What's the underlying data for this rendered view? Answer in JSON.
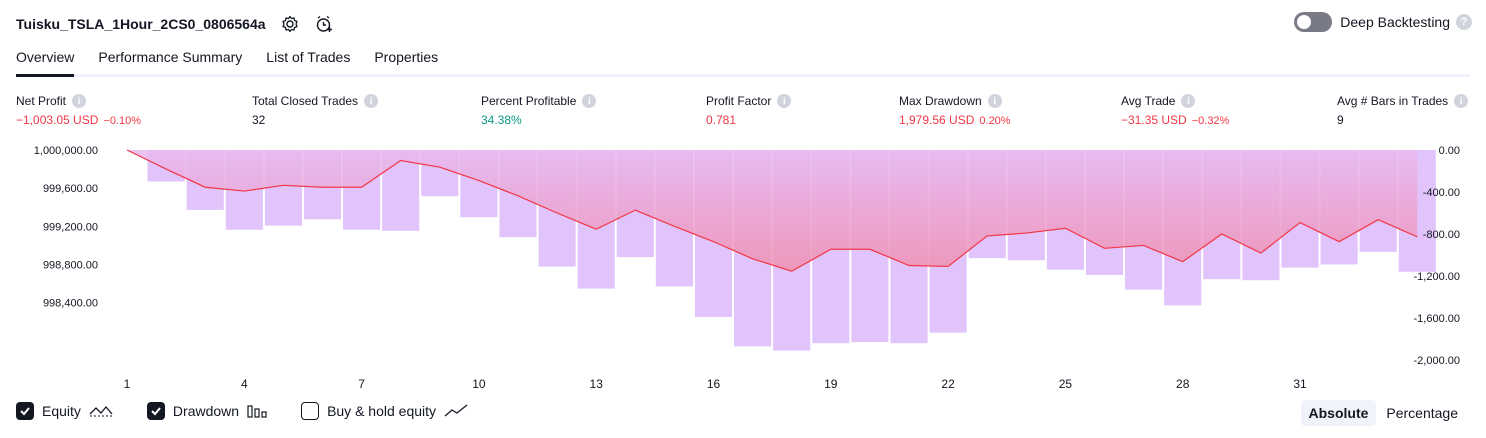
{
  "header": {
    "title": "Tuisku_TSLA_1Hour_2CS0_0806564a",
    "settings_icon": "gear-icon",
    "alert_icon": "add-alert-icon"
  },
  "deep_backtesting": {
    "label": "Deep Backtesting",
    "enabled": false,
    "help": "?"
  },
  "tabs": [
    {
      "label": "Overview",
      "active": true
    },
    {
      "label": "Performance Summary",
      "active": false
    },
    {
      "label": "List of Trades",
      "active": false
    },
    {
      "label": "Properties",
      "active": false
    }
  ],
  "metrics": [
    {
      "label": "Net Profit",
      "value": "−1,003.05 USD",
      "sub": "−0.10%",
      "tone": "neg"
    },
    {
      "label": "Total Closed Trades",
      "value": "32",
      "sub": "",
      "tone": "neu"
    },
    {
      "label": "Percent Profitable",
      "value": "34.38%",
      "sub": "",
      "tone": "pos"
    },
    {
      "label": "Profit Factor",
      "value": "0.781",
      "sub": "",
      "tone": "neg"
    },
    {
      "label": "Max Drawdown",
      "value": "1,979.56 USD",
      "sub": "0.20%",
      "tone": "neg"
    },
    {
      "label": "Avg Trade",
      "value": "−31.35 USD",
      "sub": "−0.32%",
      "tone": "neg"
    },
    {
      "label": "Avg # Bars in Trades",
      "value": "9",
      "sub": "",
      "tone": "neu"
    }
  ],
  "colors": {
    "equity_line": "#f23645",
    "drawdown_bar": "#e1c4fb",
    "area_top": "#e8b9f0",
    "area_bottom": "#f08fb0",
    "text": "#131722",
    "negative": "#f23645",
    "positive": "#089981"
  },
  "chart_data": {
    "type": "line",
    "left_axis": {
      "ticks": [
        "1,000,000.00",
        "999,600.00",
        "999,200.00",
        "998,800.00",
        "998,400.00"
      ],
      "ylim": [
        997800,
        1000000
      ]
    },
    "right_axis": {
      "ticks": [
        "0.00",
        "-400.00",
        "-800.00",
        "-1,200.00",
        "-1,600.00",
        "-2,000.00"
      ],
      "ylim": [
        -2000,
        0
      ]
    },
    "x_ticks": [
      "1",
      "4",
      "7",
      "10",
      "13",
      "16",
      "19",
      "22",
      "25",
      "28",
      "31"
    ],
    "series": [
      {
        "name": "Equity",
        "type": "line",
        "x": [
          1,
          2,
          3,
          4,
          5,
          6,
          7,
          8,
          9,
          10,
          11,
          12,
          13,
          14,
          15,
          16,
          17,
          18,
          19,
          20,
          21,
          22,
          23,
          24,
          25,
          26,
          27,
          28,
          29,
          30,
          31,
          32,
          33,
          34
        ],
        "values": [
          1000000,
          999800,
          999610,
          999570,
          999630,
          999610,
          999610,
          999890,
          999820,
          999680,
          999520,
          999340,
          999170,
          999370,
          999200,
          999040,
          998860,
          998730,
          998960,
          998960,
          998790,
          998780,
          999100,
          999130,
          999180,
          998970,
          999000,
          998830,
          999120,
          998920,
          999240,
          999040,
          999270,
          999090
        ]
      },
      {
        "name": "Drawdown",
        "type": "bar",
        "x": [
          2,
          3,
          4,
          5,
          6,
          7,
          8,
          9,
          10,
          11,
          12,
          13,
          14,
          15,
          16,
          17,
          18,
          19,
          20,
          21,
          22,
          23,
          24,
          25,
          26,
          27,
          28,
          29,
          30,
          31,
          32,
          33,
          34
        ],
        "values": [
          -300,
          -570,
          -760,
          -720,
          -660,
          -760,
          -770,
          -440,
          -640,
          -830,
          -1110,
          -1320,
          -1020,
          -1300,
          -1590,
          -1870,
          -1910,
          -1840,
          -1830,
          -1840,
          -1740,
          -1030,
          -1050,
          -1140,
          -1190,
          -1330,
          -1480,
          -1230,
          -1240,
          -1120,
          -1090,
          -970,
          -1160
        ]
      }
    ]
  },
  "legend": [
    {
      "label": "Equity",
      "checked": true,
      "icon": "equity-line-icon"
    },
    {
      "label": "Drawdown",
      "checked": true,
      "icon": "drawdown-bars-icon"
    },
    {
      "label": "Buy & hold equity",
      "checked": false,
      "icon": "buy-hold-line-icon"
    }
  ],
  "modes": [
    {
      "label": "Absolute",
      "active": true
    },
    {
      "label": "Percentage",
      "active": false
    }
  ]
}
